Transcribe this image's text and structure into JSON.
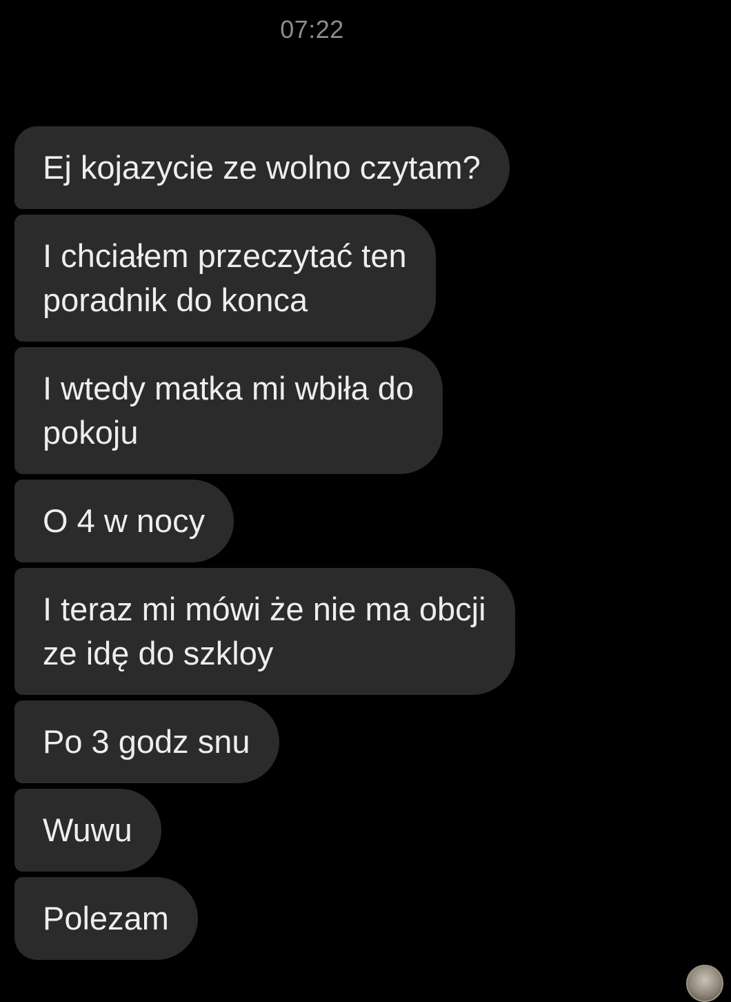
{
  "header": {
    "timestamp": "07:22"
  },
  "messages": [
    {
      "text": "Ej kojazycie ze wolno czytam?"
    },
    {
      "text": "I chciałem przeczytać ten\nporadnik do konca"
    },
    {
      "text": "I wtedy matka mi wbiła do\npokoju"
    },
    {
      "text": "O 4 w nocy"
    },
    {
      "text": "I teraz mi mówi że nie ma obcji\nze idę do szkloy"
    },
    {
      "text": "Po 3 godz snu"
    },
    {
      "text": "Wuwu"
    },
    {
      "text": "Polezam"
    }
  ],
  "colors": {
    "background": "#000000",
    "bubble": "#2b2b2b",
    "text": "#eeeeee",
    "timestamp": "#8c8c8c"
  },
  "icons": {
    "avatar": "sender-avatar"
  }
}
